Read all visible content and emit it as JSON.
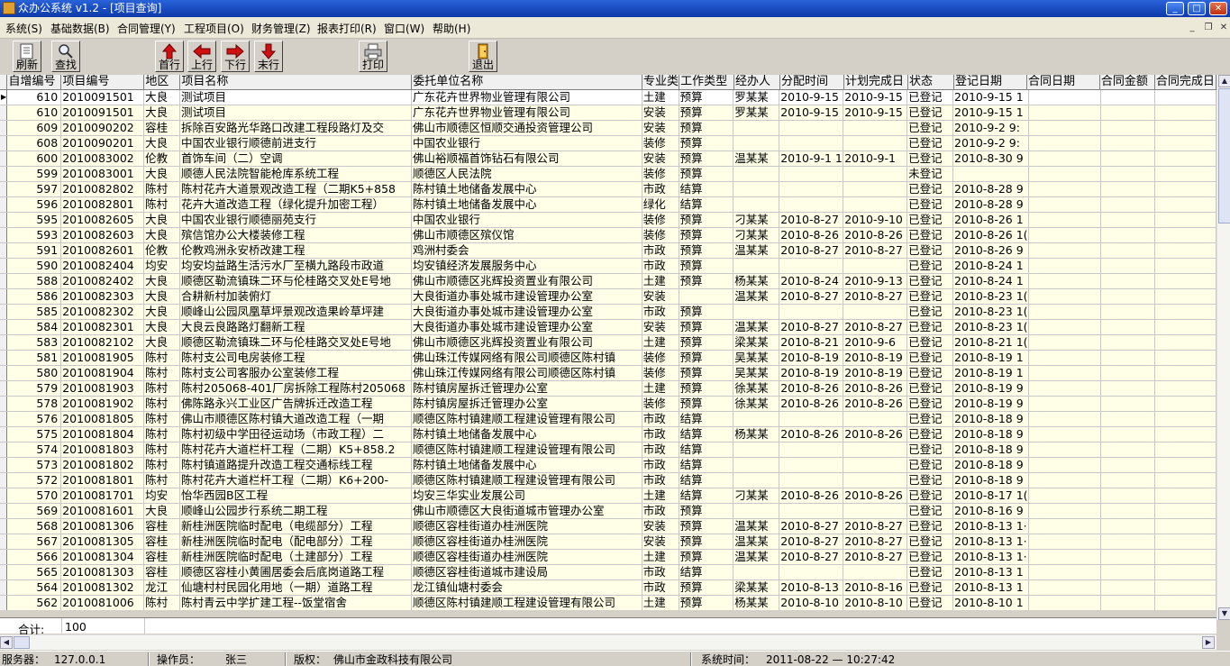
{
  "window": {
    "title": "众办公系统 v1.2 - [项目查询]"
  },
  "menu": [
    "系统(S)",
    "基础数据(B)",
    "合同管理(Y)",
    "工程项目(O)",
    "财务管理(Z)",
    "报表打印(R)",
    "窗口(W)",
    "帮助(H)"
  ],
  "toolbar": {
    "refresh": "刷新",
    "search": "查找",
    "first": "首行",
    "prev": "上行",
    "next": "下行",
    "last": "末行",
    "print": "打印",
    "exit": "退出"
  },
  "columns": [
    "自增编号",
    "项目编号",
    "地区",
    "项目名称",
    "委托单位名称",
    "专业类",
    "工作类型",
    "经办人",
    "分配时间",
    "计划完成日",
    "状态",
    "登记日期",
    "合同日期",
    "合同金额",
    "合同完成日"
  ],
  "rows": [
    [
      "610",
      "2010091501",
      "大良",
      "测试项目",
      "广东花卉世界物业管理有限公司",
      "土建",
      "预算",
      "罗某某",
      "2010-9-15",
      "2010-9-15",
      "已登记",
      "2010-9-15 1"
    ],
    [
      "610",
      "2010091501",
      "大良",
      "测试项目",
      "广东花卉世界物业管理有限公司",
      "安装",
      "预算",
      "罗某某",
      "2010-9-15",
      "2010-9-15",
      "已登记",
      "2010-9-15 1"
    ],
    [
      "609",
      "2010090202",
      "容桂",
      "拆除百安路光华路口改建工程段路灯及交",
      "佛山市顺德区恒顺交通投资管理公司",
      "安装",
      "预算",
      "",
      "",
      "",
      "已登记",
      "2010-9-2 9:"
    ],
    [
      "608",
      "2010090201",
      "大良",
      "中国农业银行顺德前进支行",
      "中国农业银行",
      "装修",
      "预算",
      "",
      "",
      "",
      "已登记",
      "2010-9-2 9:"
    ],
    [
      "600",
      "2010083002",
      "伦教",
      "首饰车间（二）空调",
      "佛山裕顺福首饰钻石有限公司",
      "安装",
      "预算",
      "温某某",
      "2010-9-1 1",
      "2010-9-1",
      "已登记",
      "2010-8-30 9"
    ],
    [
      "599",
      "2010083001",
      "大良",
      "顺德人民法院智能枪库系统工程",
      "顺德区人民法院",
      "装修",
      "预算",
      "",
      "",
      "",
      "未登记",
      ""
    ],
    [
      "597",
      "2010082802",
      "陈村",
      "陈村花卉大道景观改造工程（二期K5+858",
      "陈村镇土地储备发展中心",
      "市政",
      "结算",
      "",
      "",
      "",
      "已登记",
      "2010-8-28 9"
    ],
    [
      "596",
      "2010082801",
      "陈村",
      "花卉大道改造工程（绿化提升加密工程）",
      "陈村镇土地储备发展中心",
      "绿化",
      "结算",
      "",
      "",
      "",
      "已登记",
      "2010-8-28 9"
    ],
    [
      "595",
      "2010082605",
      "大良",
      "中国农业银行顺德丽苑支行",
      "中国农业银行",
      "装修",
      "预算",
      "刁某某",
      "2010-8-27",
      "2010-9-10",
      "已登记",
      "2010-8-26 1"
    ],
    [
      "593",
      "2010082603",
      "大良",
      "殡信馆办公大楼装修工程",
      "佛山市顺德区殡仪馆",
      "装修",
      "预算",
      "刁某某",
      "2010-8-26",
      "2010-8-26",
      "已登记",
      "2010-8-26 1("
    ],
    [
      "591",
      "2010082601",
      "伦教",
      "伦教鸡洲永安桥改建工程",
      "鸡洲村委会",
      "市政",
      "预算",
      "温某某",
      "2010-8-27",
      "2010-8-27",
      "已登记",
      "2010-8-26 9"
    ],
    [
      "590",
      "2010082404",
      "均安",
      "均安均益路生活污水厂至横九路段市政道",
      "均安镇经济发展服务中心",
      "市政",
      "预算",
      "",
      "",
      "",
      "已登记",
      "2010-8-24 1"
    ],
    [
      "588",
      "2010082402",
      "大良",
      "顺德区勒流镇珠二环与伦桂路交叉处E号地",
      "佛山市顺德区兆辉投资置业有限公司",
      "土建",
      "预算",
      "杨某某",
      "2010-8-24",
      "2010-9-13",
      "已登记",
      "2010-8-24 1"
    ],
    [
      "586",
      "2010082303",
      "大良",
      "合耕新村加装俯灯",
      "大良街道办事处城市建设管理办公室",
      "安装",
      "",
      "温某某",
      "2010-8-27",
      "2010-8-27",
      "已登记",
      "2010-8-23 1("
    ],
    [
      "585",
      "2010082302",
      "大良",
      "顺峰山公园凤凰草坪景观改造果岭草坪建",
      "大良街道办事处城市建设管理办公室",
      "市政",
      "预算",
      "",
      "",
      "",
      "已登记",
      "2010-8-23 1("
    ],
    [
      "584",
      "2010082301",
      "大良",
      "大良云良路路灯翻新工程",
      "大良街道办事处城市建设管理办公室",
      "安装",
      "预算",
      "温某某",
      "2010-8-27",
      "2010-8-27",
      "已登记",
      "2010-8-23 1("
    ],
    [
      "583",
      "2010082102",
      "大良",
      "顺德区勒流镇珠二环与伦桂路交叉处E号地",
      "佛山市顺德区兆辉投资置业有限公司",
      "土建",
      "预算",
      "梁某某",
      "2010-8-21",
      "2010-9-6",
      "已登记",
      "2010-8-21 1("
    ],
    [
      "581",
      "2010081905",
      "陈村",
      "陈村支公司电房装修工程",
      "佛山珠江传媒网络有限公司顺德区陈村镇",
      "装修",
      "预算",
      "吴某某",
      "2010-8-19",
      "2010-8-19",
      "已登记",
      "2010-8-19 1"
    ],
    [
      "580",
      "2010081904",
      "陈村",
      "陈村支公司客服办公室装修工程",
      "佛山珠江传媒网络有限公司顺德区陈村镇",
      "装修",
      "预算",
      "吴某某",
      "2010-8-19",
      "2010-8-19",
      "已登记",
      "2010-8-19 1"
    ],
    [
      "579",
      "2010081903",
      "陈村",
      "陈村205068-401厂房拆除工程陈村205068",
      "陈村镇房屋拆迁管理办公室",
      "土建",
      "预算",
      "徐某某",
      "2010-8-26",
      "2010-8-26",
      "已登记",
      "2010-8-19 9"
    ],
    [
      "578",
      "2010081902",
      "陈村",
      "佛陈路永兴工业区广告牌拆迁改造工程",
      "陈村镇房屋拆迁管理办公室",
      "装修",
      "预算",
      "徐某某",
      "2010-8-26",
      "2010-8-26",
      "已登记",
      "2010-8-19 9"
    ],
    [
      "576",
      "2010081805",
      "陈村",
      "佛山市顺德区陈村镇大道改造工程（一期",
      "顺德区陈村镇建顺工程建设管理有限公司",
      "市政",
      "结算",
      "",
      "",
      "",
      "已登记",
      "2010-8-18 9"
    ],
    [
      "575",
      "2010081804",
      "陈村",
      "陈村初级中学田径运动场（市政工程）二",
      "陈村镇土地储备发展中心",
      "市政",
      "结算",
      "杨某某",
      "2010-8-26",
      "2010-8-26",
      "已登记",
      "2010-8-18 9"
    ],
    [
      "574",
      "2010081803",
      "陈村",
      "陈村花卉大道栏杆工程（二期）K5+858.2",
      "顺德区陈村镇建顺工程建设管理有限公司",
      "市政",
      "结算",
      "",
      "",
      "",
      "已登记",
      "2010-8-18 9"
    ],
    [
      "573",
      "2010081802",
      "陈村",
      "陈村镇道路提升改造工程交通标线工程",
      "陈村镇土地储备发展中心",
      "市政",
      "结算",
      "",
      "",
      "",
      "已登记",
      "2010-8-18 9"
    ],
    [
      "572",
      "2010081801",
      "陈村",
      "陈村花卉大道栏杆工程（二期）K6+200-",
      "顺德区陈村镇建顺工程建设管理有限公司",
      "市政",
      "结算",
      "",
      "",
      "",
      "已登记",
      "2010-8-18 9"
    ],
    [
      "570",
      "2010081701",
      "均安",
      "怡华西园B区工程",
      "均安三华实业发展公司",
      "土建",
      "结算",
      "刁某某",
      "2010-8-26",
      "2010-8-26",
      "已登记",
      "2010-8-17 1("
    ],
    [
      "569",
      "2010081601",
      "大良",
      "顺峰山公园步行系统二期工程",
      "佛山市顺德区大良街道城市管理办公室",
      "市政",
      "预算",
      "",
      "",
      "",
      "已登记",
      "2010-8-16 9"
    ],
    [
      "568",
      "2010081306",
      "容桂",
      "新桂洲医院临时配电（电缆部分）工程",
      "顺德区容桂街道办桂洲医院",
      "安装",
      "预算",
      "温某某",
      "2010-8-27",
      "2010-8-27",
      "已登记",
      "2010-8-13 1·"
    ],
    [
      "567",
      "2010081305",
      "容桂",
      "新桂洲医院临时配电（配电部分）工程",
      "顺德区容桂街道办桂洲医院",
      "安装",
      "预算",
      "温某某",
      "2010-8-27",
      "2010-8-27",
      "已登记",
      "2010-8-13 1·"
    ],
    [
      "566",
      "2010081304",
      "容桂",
      "新桂洲医院临时配电（土建部分）工程",
      "顺德区容桂街道办桂洲医院",
      "土建",
      "预算",
      "温某某",
      "2010-8-27",
      "2010-8-27",
      "已登记",
      "2010-8-13 1·"
    ],
    [
      "565",
      "2010081303",
      "容桂",
      "顺德区容桂小黄圃居委会后底岗道路工程",
      "顺德区容桂街道城市建设局",
      "市政",
      "结算",
      "",
      "",
      "",
      "已登记",
      "2010-8-13 1"
    ],
    [
      "564",
      "2010081302",
      "龙江",
      "仙塘村村民园化用地（一期）道路工程",
      "龙江镇仙塘村委会",
      "市政",
      "预算",
      "梁某某",
      "2010-8-13",
      "2010-8-16",
      "已登记",
      "2010-8-13 1"
    ],
    [
      "562",
      "2010081006",
      "陈村",
      "陈村青云中学扩建工程--饭堂宿舍",
      "顺德区陈村镇建顺工程建设管理有限公司",
      "土建",
      "预算",
      "杨某某",
      "2010-8-10",
      "2010-8-10",
      "已登记",
      "2010-8-10 1"
    ]
  ],
  "summary": {
    "label": "合计:",
    "value": "100"
  },
  "status": {
    "server_label": "服务器：",
    "server": "127.0.0.1",
    "operator_label": "操作员：",
    "operator": "张三",
    "copyright_label": "版权：",
    "copyright": "佛山市金政科技有限公司",
    "time_label": "系统时间：",
    "time": "2011-08-22 — 10:27:42"
  }
}
